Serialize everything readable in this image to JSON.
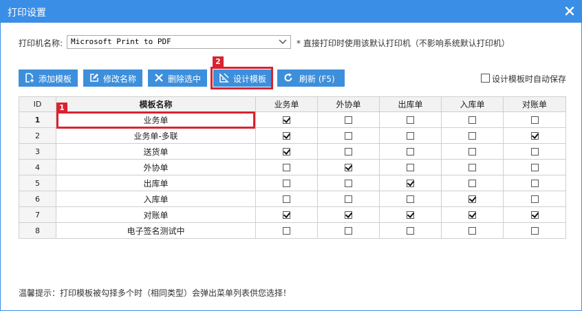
{
  "window": {
    "title": "打印设置"
  },
  "printer": {
    "label": "打印机名称:",
    "selected": "Microsoft Print to PDF",
    "note": "* 直接打印时使用该默认打印机（不影响系统默认打印机）"
  },
  "toolbar": {
    "add_label": "添加模板",
    "rename_label": "修改名称",
    "delete_label": "删除选中",
    "design_label": "设计模板",
    "refresh_label": "刷新 (F5)",
    "design_badge": "2"
  },
  "autosave": {
    "label": "设计模板时自动保存",
    "checked": false
  },
  "table": {
    "headers": [
      "ID",
      "模板名称",
      "业务单",
      "外协单",
      "出库单",
      "入库单",
      "对账单"
    ],
    "name_badge": "1",
    "rows": [
      {
        "id": "1",
        "name": "业务单",
        "checks": [
          true,
          false,
          false,
          false,
          false
        ]
      },
      {
        "id": "2",
        "name": "业务单-多联",
        "checks": [
          true,
          false,
          false,
          false,
          true
        ]
      },
      {
        "id": "3",
        "name": "送货单",
        "checks": [
          true,
          false,
          false,
          false,
          false
        ]
      },
      {
        "id": "4",
        "name": "外协单",
        "checks": [
          false,
          true,
          false,
          false,
          false
        ]
      },
      {
        "id": "5",
        "name": "出库单",
        "checks": [
          false,
          false,
          true,
          false,
          false
        ]
      },
      {
        "id": "6",
        "name": "入库单",
        "checks": [
          false,
          false,
          false,
          true,
          false
        ]
      },
      {
        "id": "7",
        "name": "对账单",
        "checks": [
          true,
          true,
          true,
          true,
          true
        ]
      },
      {
        "id": "8",
        "name": "电子签名测试中",
        "checks": [
          false,
          false,
          false,
          false,
          false
        ]
      }
    ]
  },
  "hint": "温馨提示：打印模板被勾择多个时（相同类型）会弹出菜单列表供您选择！",
  "colors": {
    "titlebar": "#3a8ee6",
    "button": "#3d8fdc",
    "highlight": "#d9232f"
  }
}
